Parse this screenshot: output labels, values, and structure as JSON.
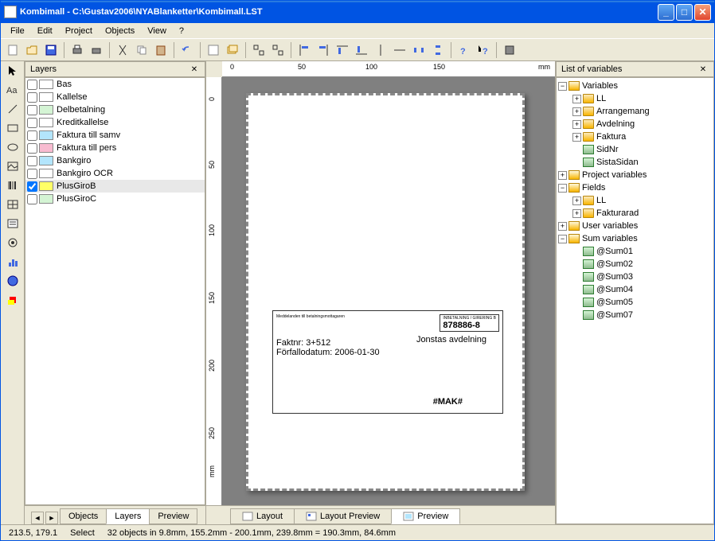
{
  "window": {
    "title": "Kombimall - C:\\Gustav2006\\NYABlanketter\\Kombimall.LST"
  },
  "menu": {
    "file": "File",
    "edit": "Edit",
    "project": "Project",
    "objects": "Objects",
    "view": "View",
    "help": "?"
  },
  "panels": {
    "layers": {
      "title": "Layers"
    },
    "rightpanel": {
      "title": "List of variables"
    }
  },
  "layers": [
    {
      "name": "Bas",
      "color": "#ffffff",
      "checked": false
    },
    {
      "name": "Kallelse",
      "color": "#ffffff",
      "checked": false
    },
    {
      "name": "Delbetalning",
      "color": "#d4f4d4",
      "checked": false
    },
    {
      "name": "Kreditkallelse",
      "color": "#ffffff",
      "checked": false
    },
    {
      "name": "Faktura till samv",
      "color": "#b3e5fc",
      "checked": false
    },
    {
      "name": "Faktura till pers",
      "color": "#f8bbd0",
      "checked": false
    },
    {
      "name": "Bankgiro",
      "color": "#b3e5fc",
      "checked": false
    },
    {
      "name": "Bankgiro OCR",
      "color": "#ffffff",
      "checked": false
    },
    {
      "name": "PlusGiroB",
      "color": "#ffff66",
      "checked": true,
      "selected": true
    },
    {
      "name": "PlusGiroC",
      "color": "#d4f4d4",
      "checked": false
    }
  ],
  "lefttabs": {
    "objects": "Objects",
    "layers": "Layers",
    "preview": "Preview"
  },
  "centertabs": {
    "layout": "Layout",
    "layoutpreview": "Layout Preview",
    "preview": "Preview"
  },
  "ruler": {
    "unit": "mm",
    "hticks": [
      "0",
      "50",
      "100",
      "150"
    ],
    "vticks": [
      "0",
      "50",
      "100",
      "150",
      "200",
      "250"
    ],
    "vunit": "mm"
  },
  "vartree": [
    {
      "level": 0,
      "exp": "-",
      "icon": "var",
      "label": "Variables"
    },
    {
      "level": 1,
      "exp": "+",
      "icon": "folder",
      "label": "LL"
    },
    {
      "level": 1,
      "exp": "+",
      "icon": "folder",
      "label": "Arrangemang"
    },
    {
      "level": 1,
      "exp": "+",
      "icon": "folder",
      "label": "Avdelning"
    },
    {
      "level": 1,
      "exp": "+",
      "icon": "folder",
      "label": "Faktura"
    },
    {
      "level": 1,
      "exp": "",
      "icon": "field",
      "label": "SidNr"
    },
    {
      "level": 1,
      "exp": "",
      "icon": "field",
      "label": "SistaSidan"
    },
    {
      "level": 0,
      "exp": "+",
      "icon": "var",
      "label": "Project variables"
    },
    {
      "level": 0,
      "exp": "-",
      "icon": "var",
      "label": "Fields"
    },
    {
      "level": 1,
      "exp": "+",
      "icon": "folder",
      "label": "LL"
    },
    {
      "level": 1,
      "exp": "+",
      "icon": "folder",
      "label": "Fakturarad"
    },
    {
      "level": 0,
      "exp": "+",
      "icon": "var",
      "label": "User variables"
    },
    {
      "level": 0,
      "exp": "-",
      "icon": "var",
      "label": "Sum variables"
    },
    {
      "level": 1,
      "exp": "",
      "icon": "field",
      "label": "@Sum01"
    },
    {
      "level": 1,
      "exp": "",
      "icon": "field",
      "label": "@Sum02"
    },
    {
      "level": 1,
      "exp": "",
      "icon": "field",
      "label": "@Sum03"
    },
    {
      "level": 1,
      "exp": "",
      "icon": "field",
      "label": "@Sum04"
    },
    {
      "level": 1,
      "exp": "",
      "icon": "field",
      "label": "@Sum05"
    },
    {
      "level": 1,
      "exp": "",
      "icon": "field",
      "label": "@Sum07"
    }
  ],
  "status": {
    "coords": "213.5, 179.1",
    "mode": "Select",
    "info": "32 objects in  9.8mm, 155.2mm  -  200.1mm, 239.8mm  =  190.3mm, 84.6mm"
  },
  "pagepreview": {
    "hdr": "INBETALNING / GIRERING B",
    "num": "878886-8",
    "f1": "Faktnr: 3+512",
    "f2": "Förfallodatum: 2006-01-30",
    "avd": "Jonstas avdelning",
    "mak": "#MAK#"
  }
}
